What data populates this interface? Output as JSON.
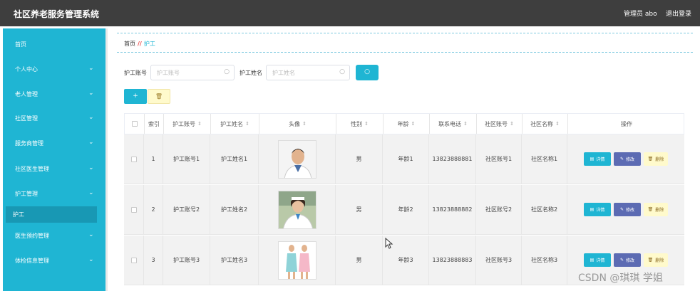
{
  "header": {
    "app_title": "社区养老服务管理系统",
    "admin_label": "管理员 abo",
    "logout_label": "退出登录"
  },
  "sidebar": {
    "items": [
      {
        "label": "首页",
        "has_chevron": false
      },
      {
        "label": "个人中心",
        "has_chevron": true
      },
      {
        "label": "老人管理",
        "has_chevron": true
      },
      {
        "label": "社区管理",
        "has_chevron": true
      },
      {
        "label": "服务商管理",
        "has_chevron": true
      },
      {
        "label": "社区医生管理",
        "has_chevron": true
      },
      {
        "label": "护工管理",
        "has_chevron": true
      },
      {
        "label": "医生预约管理",
        "has_chevron": true
      },
      {
        "label": "体检信息管理",
        "has_chevron": true
      }
    ],
    "active_sub": "护工",
    "chevron_glyph": "⌄"
  },
  "breadcrumb": {
    "home": "首页",
    "separator": "//",
    "current": "护工"
  },
  "search": {
    "account_label": "护工账号",
    "account_placeholder": "护工账号",
    "name_label": "护工姓名",
    "name_placeholder": "护工姓名",
    "search_icon": "search-icon"
  },
  "actions": {
    "add_label": "+",
    "delete_icon": "🗑"
  },
  "table": {
    "columns": {
      "index": "索引",
      "account": "护工账号",
      "name": "护工姓名",
      "avatar": "头像",
      "gender": "性别",
      "age": "年龄",
      "phone": "联系电话",
      "community_account": "社区账号",
      "community_name": "社区名称",
      "operations": "操作"
    },
    "sort_glyph": "⇕",
    "rows": [
      {
        "index": "1",
        "account": "护工账号1",
        "name": "护工姓名1",
        "gender": "男",
        "age": "年龄1",
        "phone": "13823888881",
        "community_account": "社区账号1",
        "community_name": "社区名称1"
      },
      {
        "index": "2",
        "account": "护工账号2",
        "name": "护工姓名2",
        "gender": "男",
        "age": "年龄2",
        "phone": "13823888882",
        "community_account": "社区账号2",
        "community_name": "社区名称2"
      },
      {
        "index": "3",
        "account": "护工账号3",
        "name": "护工姓名3",
        "gender": "男",
        "age": "年龄3",
        "phone": "13823888883",
        "community_account": "社区账号3",
        "community_name": "社区名称3"
      }
    ],
    "row_actions": {
      "detail": "详情",
      "edit": "修改",
      "delete": "删除"
    }
  },
  "colors": {
    "topbar": "#3e3e3e",
    "sidebar": "#1fb5d3",
    "sidebar_active": "#1898b4",
    "edit_button": "#5c6bb3",
    "delete_button": "#fffacc"
  },
  "watermark": "CSDN @琪琪 学姐"
}
